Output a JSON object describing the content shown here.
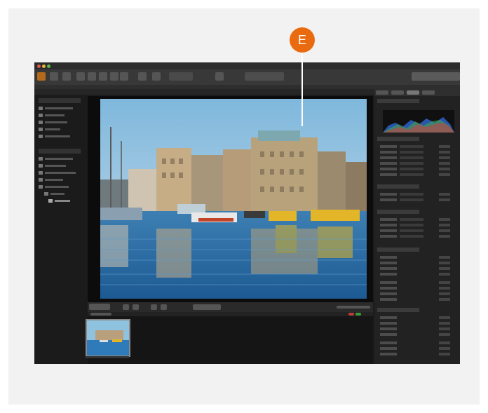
{
  "marker": {
    "letter": "E",
    "color": "#ea6a10"
  },
  "app": {
    "traffic_lights": [
      "#e05b4c",
      "#e3b341",
      "#5fb649"
    ],
    "toolbar_icons": [
      "folder-icon",
      "camera-icon",
      "grid-view-icon",
      "single-view-icon",
      "compare-icon",
      "compare-icon",
      "info-icon",
      "crop-icon",
      "straighten-icon",
      "search-field",
      "export-icon",
      "workspace-switcher"
    ]
  },
  "photo": {
    "subject": "harbor",
    "palette": {
      "sky": "#8ec2de",
      "water": "#2f7ab8",
      "buildings": "#b9a07c",
      "boat_yellow": "#e2b628",
      "boat_red": "#c24428"
    }
  },
  "right_panel": {
    "histogram_colors": [
      "#2f6ee0",
      "#4aa34a",
      "#d23d3d"
    ]
  }
}
